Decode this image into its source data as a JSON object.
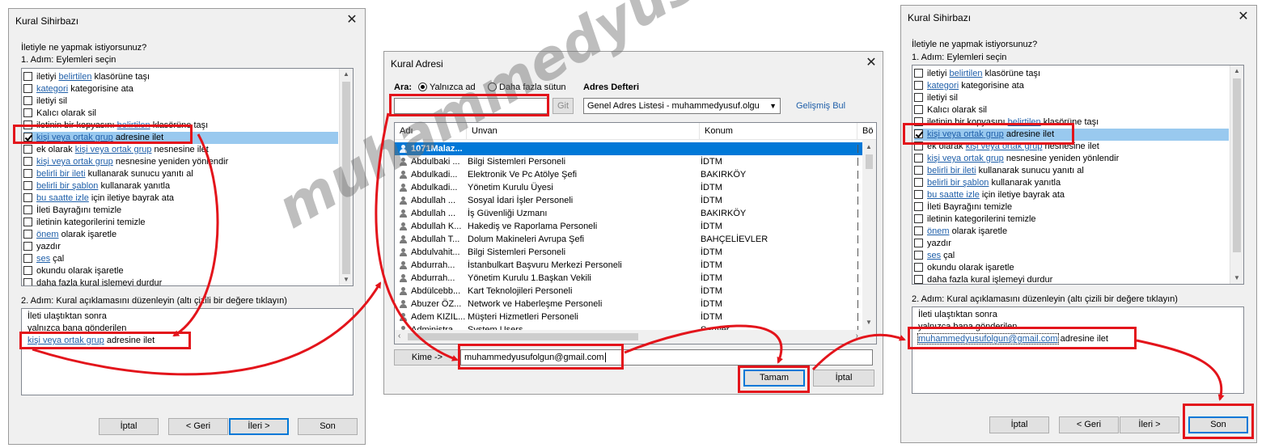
{
  "watermark": "muhammedyusufolgun.blogspot.com",
  "colors": {
    "highlight": "#e3141b",
    "link": "#1f5fa9",
    "selection": "#99c9ef",
    "addr_selection": "#0078d7"
  },
  "wizard": {
    "title": "Kural Sihirbazı",
    "question": "İletiyle ne yapmak istiyorsunuz?",
    "step1": "1. Adım: Eylemleri seçin",
    "actions": [
      {
        "checked": false,
        "link": "",
        "pre": "iletiyi ",
        "lk": "belirtilen",
        "post": " klasörüne taşı"
      },
      {
        "checked": false,
        "pre": "",
        "lk": "kategori",
        "post": " kategorisine ata"
      },
      {
        "checked": false,
        "pre": "iletiyi sil",
        "lk": "",
        "post": ""
      },
      {
        "checked": false,
        "pre": "Kalıcı olarak sil",
        "lk": "",
        "post": ""
      },
      {
        "checked": false,
        "pre": "iletinin bir kopyasını ",
        "lk": "belirtilen",
        "post": " klasörüne taşı"
      },
      {
        "checked": true,
        "pre": "",
        "lk": "kişi veya ortak grup",
        "post": " adresine ilet"
      },
      {
        "checked": false,
        "pre": "ek olarak ",
        "lk": "kişi veya ortak grup",
        "post": " nesnesine ilet"
      },
      {
        "checked": false,
        "pre": "",
        "lk": "kişi veya ortak grup",
        "post": " nesnesine yeniden yönlendir"
      },
      {
        "checked": false,
        "pre": "",
        "lk": "belirli bir ileti",
        "post": " kullanarak sunucu yanıtı al"
      },
      {
        "checked": false,
        "pre": "",
        "lk": "belirli bir şablon",
        "post": " kullanarak yanıtla"
      },
      {
        "checked": false,
        "pre": "",
        "lk": "bu saatte izle",
        "post": " için iletiye bayrak ata"
      },
      {
        "checked": false,
        "pre": "İleti Bayrağını temizle",
        "lk": "",
        "post": ""
      },
      {
        "checked": false,
        "pre": "iletinin kategorilerini temizle",
        "lk": "",
        "post": ""
      },
      {
        "checked": false,
        "pre": "",
        "lk": "önem",
        "post": " olarak işaretle"
      },
      {
        "checked": false,
        "pre": "yazdır",
        "lk": "",
        "post": ""
      },
      {
        "checked": false,
        "pre": "",
        "lk": "ses",
        "post": " çal"
      },
      {
        "checked": false,
        "pre": "okundu olarak işaretle",
        "lk": "",
        "post": ""
      },
      {
        "checked": false,
        "pre": "daha fazla kural işlemeyi durdur",
        "lk": "",
        "post": ""
      }
    ],
    "step2": "2. Adım: Kural açıklamasını düzenleyin (altı çizili bir değere tıklayın)",
    "desc_line1": "İleti ulaştıktan sonra",
    "desc_line2": "yalnızca bana gönderilen",
    "desc_link_left": "kişi veya ortak grup",
    "desc_link_right": "muhammedyusufolgun@gmail.com",
    "desc_suffix": " adresine ilet",
    "buttons": {
      "cancel": "İptal",
      "back": "< Geri",
      "next": "İleri >",
      "finish": "Son"
    }
  },
  "address": {
    "title": "Kural Adresi",
    "search_label": "Ara:",
    "radio_name_only": "Yalnızca ad",
    "radio_more_columns": "Daha fazla sütun",
    "address_book_label": "Adres Defteri",
    "search_value": "",
    "go_button": "Git",
    "address_book_value": "Genel Adres Listesi - muhammedyusuf.olgu",
    "advanced_find": "Gelişmiş Bul",
    "columns": [
      "Adı",
      "Unvan",
      "Konum",
      "Bö"
    ],
    "rows": [
      {
        "name": "1071Malaz...",
        "title": "",
        "location": "",
        "group": true
      },
      {
        "name": "Abdulbaki ...",
        "title": "Bilgi Sistemleri Personeli",
        "location": "İDTM"
      },
      {
        "name": "Abdulkadi...",
        "title": "Elektronik Ve Pc Atölye Şefi",
        "location": "BAKIRKÖY"
      },
      {
        "name": "Abdulkadi...",
        "title": "Yönetim Kurulu Üyesi",
        "location": "İDTM"
      },
      {
        "name": "Abdullah ...",
        "title": "Sosyal İdari İşler Personeli",
        "location": "İDTM"
      },
      {
        "name": "Abdullah ...",
        "title": "İş Güvenliği Uzmanı",
        "location": "BAKIRKÖY"
      },
      {
        "name": "Abdullah K...",
        "title": "Hakediş ve Raporlama Personeli",
        "location": "İDTM"
      },
      {
        "name": "Abdullah T...",
        "title": "Dolum Makineleri Avrupa Şefi",
        "location": "BAHÇELİEVLER"
      },
      {
        "name": "Abdulvahit...",
        "title": "Bilgi Sistemleri Personeli",
        "location": "İDTM"
      },
      {
        "name": "Abdurrah...",
        "title": "İstanbulkart Başvuru Merkezi Personeli",
        "location": "İDTM"
      },
      {
        "name": "Abdurrah...",
        "title": "Yönetim Kurulu 1.Başkan Vekili",
        "location": "İDTM"
      },
      {
        "name": "Abdülcebb...",
        "title": "Kart Teknolojileri Personeli",
        "location": "İDTM"
      },
      {
        "name": "Abuzer ÖZ...",
        "title": "Network ve Haberleşme Personeli",
        "location": "İDTM"
      },
      {
        "name": "Adem KIZIL...",
        "title": "Müşteri Hizmetleri Personeli",
        "location": "İDTM"
      },
      {
        "name": "Administra...",
        "title": "System Users",
        "location": "Sarıyer"
      }
    ],
    "to_button": "Kime ->",
    "to_value": "muhammedyusufolgun@gmail.com",
    "ok": "Tamam",
    "cancel": "İptal"
  }
}
